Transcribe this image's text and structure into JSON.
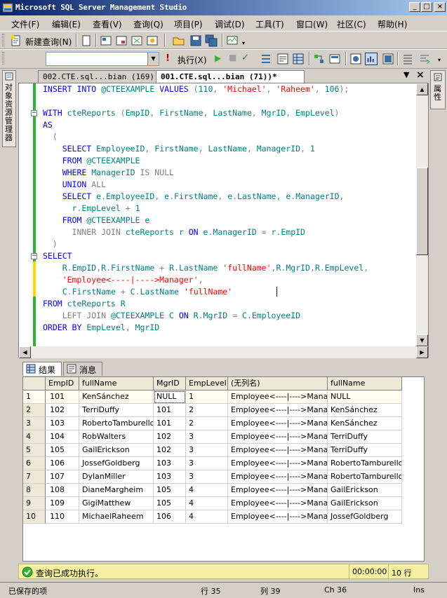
{
  "window": {
    "title": "Microsoft SQL Server Management Studio",
    "min_glyph": "_",
    "max_glyph": "□",
    "close_glyph": "×"
  },
  "menu": [
    "文件(F)",
    "编辑(E)",
    "查看(V)",
    "查询(Q)",
    "项目(P)",
    "调试(D)",
    "工具(T)",
    "窗口(W)",
    "社区(C)",
    "帮助(H)"
  ],
  "toolbar": {
    "new_query": "新建查询(N)",
    "execute": "执行(X)",
    "database_value": ""
  },
  "side_panels": {
    "left": "对象资源管理器",
    "right": "属性"
  },
  "doc_tabs": [
    {
      "label": "002.CTE.sql...bian (169))",
      "active": false
    },
    {
      "label": "001.CTE.sql...bian (71))*",
      "active": true
    }
  ],
  "doc_tab_controls": {
    "dropdown": "▼",
    "close": "×"
  },
  "colors": {
    "keyword": "#0000ff",
    "identifier": "#008080",
    "string": "#ff0000",
    "operator": "#808080",
    "change_bar": "#2fb52f",
    "status_yellow": "#f5f0a0"
  },
  "code_lines": [
    [
      [
        "kw",
        "INSERT INTO "
      ],
      [
        "id",
        "@CTEEXAMPLE "
      ],
      [
        "kw",
        "VALUES "
      ],
      [
        "gr",
        "("
      ],
      [
        "id",
        "110"
      ],
      [
        "gr",
        ", "
      ],
      [
        "str",
        "'Michael'"
      ],
      [
        "gr",
        ", "
      ],
      [
        "str",
        "'Raheem'"
      ],
      [
        "gr",
        ", "
      ],
      [
        "id",
        "106"
      ],
      [
        "gr",
        ");"
      ]
    ],
    [],
    [
      [
        "kw",
        "WITH "
      ],
      [
        "id",
        "cteReports "
      ],
      [
        "gr",
        "("
      ],
      [
        "id",
        "EmpID"
      ],
      [
        "gr",
        ", "
      ],
      [
        "id",
        "FirstName"
      ],
      [
        "gr",
        ", "
      ],
      [
        "id",
        "LastName"
      ],
      [
        "gr",
        ", "
      ],
      [
        "id",
        "MgrID"
      ],
      [
        "gr",
        ", "
      ],
      [
        "id",
        "EmpLevel"
      ],
      [
        "gr",
        ")"
      ]
    ],
    [
      [
        "kw",
        "AS"
      ]
    ],
    [
      [
        "gr",
        "  ("
      ]
    ],
    [
      [
        "kw",
        "    SELECT "
      ],
      [
        "id",
        "EmployeeID"
      ],
      [
        "gr",
        ", "
      ],
      [
        "id",
        "FirstName"
      ],
      [
        "gr",
        ", "
      ],
      [
        "id",
        "LastName"
      ],
      [
        "gr",
        ", "
      ],
      [
        "id",
        "ManagerID"
      ],
      [
        "gr",
        ", "
      ],
      [
        "id",
        "1"
      ]
    ],
    [
      [
        "kw",
        "    FROM "
      ],
      [
        "id",
        "@CTEEXAMPLE"
      ]
    ],
    [
      [
        "kw",
        "    WHERE "
      ],
      [
        "id",
        "ManagerID "
      ],
      [
        "gr",
        "IS NULL"
      ]
    ],
    [
      [
        "kw",
        "    UNION "
      ],
      [
        "gr",
        "ALL"
      ]
    ],
    [
      [
        "kw",
        "    SELECT "
      ],
      [
        "id",
        "e"
      ],
      [
        "gr",
        "."
      ],
      [
        "id",
        "EmployeeID"
      ],
      [
        "gr",
        ", "
      ],
      [
        "id",
        "e"
      ],
      [
        "gr",
        "."
      ],
      [
        "id",
        "FirstName"
      ],
      [
        "gr",
        ", "
      ],
      [
        "id",
        "e"
      ],
      [
        "gr",
        "."
      ],
      [
        "id",
        "LastName"
      ],
      [
        "gr",
        ", "
      ],
      [
        "id",
        "e"
      ],
      [
        "gr",
        "."
      ],
      [
        "id",
        "ManagerID"
      ],
      [
        "gr",
        ","
      ]
    ],
    [
      [
        "id",
        "      r"
      ],
      [
        "gr",
        "."
      ],
      [
        "id",
        "EmpLevel "
      ],
      [
        "gr",
        "+ "
      ],
      [
        "id",
        "1"
      ]
    ],
    [
      [
        "kw",
        "    FROM "
      ],
      [
        "id",
        "@CTEEXAMPLE e"
      ]
    ],
    [
      [
        "gr",
        "      INNER JOIN "
      ],
      [
        "id",
        "cteReports r "
      ],
      [
        "kw",
        "ON "
      ],
      [
        "id",
        "e"
      ],
      [
        "gr",
        "."
      ],
      [
        "id",
        "ManagerID "
      ],
      [
        "gr",
        "= "
      ],
      [
        "id",
        "r"
      ],
      [
        "gr",
        "."
      ],
      [
        "id",
        "EmpID"
      ]
    ],
    [
      [
        "gr",
        "  )"
      ]
    ],
    [
      [
        "kw",
        "SELECT"
      ]
    ],
    [
      [
        "id",
        "    R"
      ],
      [
        "gr",
        "."
      ],
      [
        "id",
        "EmpID"
      ],
      [
        "gr",
        ","
      ],
      [
        "id",
        "R"
      ],
      [
        "gr",
        "."
      ],
      [
        "id",
        "FirstName "
      ],
      [
        "gr",
        "+ "
      ],
      [
        "id",
        "R"
      ],
      [
        "gr",
        "."
      ],
      [
        "id",
        "LastName "
      ],
      [
        "str",
        "'fullName'"
      ],
      [
        "gr",
        ","
      ],
      [
        "id",
        "R"
      ],
      [
        "gr",
        "."
      ],
      [
        "id",
        "MgrID"
      ],
      [
        "gr",
        ","
      ],
      [
        "id",
        "R"
      ],
      [
        "gr",
        "."
      ],
      [
        "id",
        "EmpLevel"
      ],
      [
        "gr",
        ","
      ]
    ],
    [
      [
        "str",
        "    'Employee<----|---->Manager'"
      ],
      [
        "gr",
        ","
      ]
    ],
    [
      [
        "id",
        "    C"
      ],
      [
        "gr",
        "."
      ],
      [
        "id",
        "FirstName "
      ],
      [
        "gr",
        "+ "
      ],
      [
        "id",
        "C"
      ],
      [
        "gr",
        "."
      ],
      [
        "id",
        "LastName "
      ],
      [
        "str",
        "'fullName'"
      ]
    ],
    [
      [
        "kw",
        "FROM "
      ],
      [
        "id",
        "cteReports R"
      ]
    ],
    [
      [
        "gr",
        "    LEFT JOIN "
      ],
      [
        "id",
        "@CTEEXAMPLE C "
      ],
      [
        "kw",
        "ON "
      ],
      [
        "id",
        "R"
      ],
      [
        "gr",
        "."
      ],
      [
        "id",
        "MgrID "
      ],
      [
        "gr",
        "= "
      ],
      [
        "id",
        "C"
      ],
      [
        "gr",
        "."
      ],
      [
        "id",
        "EmployeeID"
      ]
    ],
    [
      [
        "kw",
        "ORDER BY "
      ],
      [
        "id",
        "EmpLevel"
      ],
      [
        "gr",
        ", "
      ],
      [
        "id",
        "MgrID"
      ]
    ]
  ],
  "results": {
    "tabs": [
      "结果",
      "消息"
    ],
    "columns": [
      "EmpID",
      "fullName",
      "MgrID",
      "EmpLevel",
      "(无列名)",
      "fullName"
    ],
    "rows": [
      [
        "1",
        "101",
        "KenSánchez",
        "NULL",
        "1",
        "Employee<----|---->Manager",
        "NULL"
      ],
      [
        "2",
        "102",
        "TerriDuffy",
        "101",
        "2",
        "Employee<----|---->Manager",
        "KenSánchez"
      ],
      [
        "3",
        "103",
        "RobertoTamburello",
        "101",
        "2",
        "Employee<----|---->Manager",
        "KenSánchez"
      ],
      [
        "4",
        "104",
        "RobWalters",
        "102",
        "3",
        "Employee<----|---->Manager",
        "TerriDuffy"
      ],
      [
        "5",
        "105",
        "GailErickson",
        "102",
        "3",
        "Employee<----|---->Manager",
        "TerriDuffy"
      ],
      [
        "6",
        "106",
        "JossefGoldberg",
        "103",
        "3",
        "Employee<----|---->Manager",
        "RobertoTamburello"
      ],
      [
        "7",
        "107",
        "DylanMiller",
        "103",
        "3",
        "Employee<----|---->Manager",
        "RobertoTamburello"
      ],
      [
        "8",
        "108",
        "DianeMargheim",
        "105",
        "4",
        "Employee<----|---->Manager",
        "GailErickson"
      ],
      [
        "9",
        "109",
        "GigiMatthew",
        "105",
        "4",
        "Employee<----|---->Manager",
        "GailErickson"
      ],
      [
        "10",
        "110",
        "MichaelRaheem",
        "106",
        "4",
        "Employee<----|---->Manager",
        "JossefGoldberg"
      ]
    ]
  },
  "query_status": {
    "message": "查询已成功执行。",
    "elapsed": "00:00:00",
    "rows": "10 行"
  },
  "statusbar": {
    "state": "已保存的项",
    "line": "行 35",
    "col": "列 39",
    "ch": "Ch 36",
    "mode": "Ins"
  }
}
